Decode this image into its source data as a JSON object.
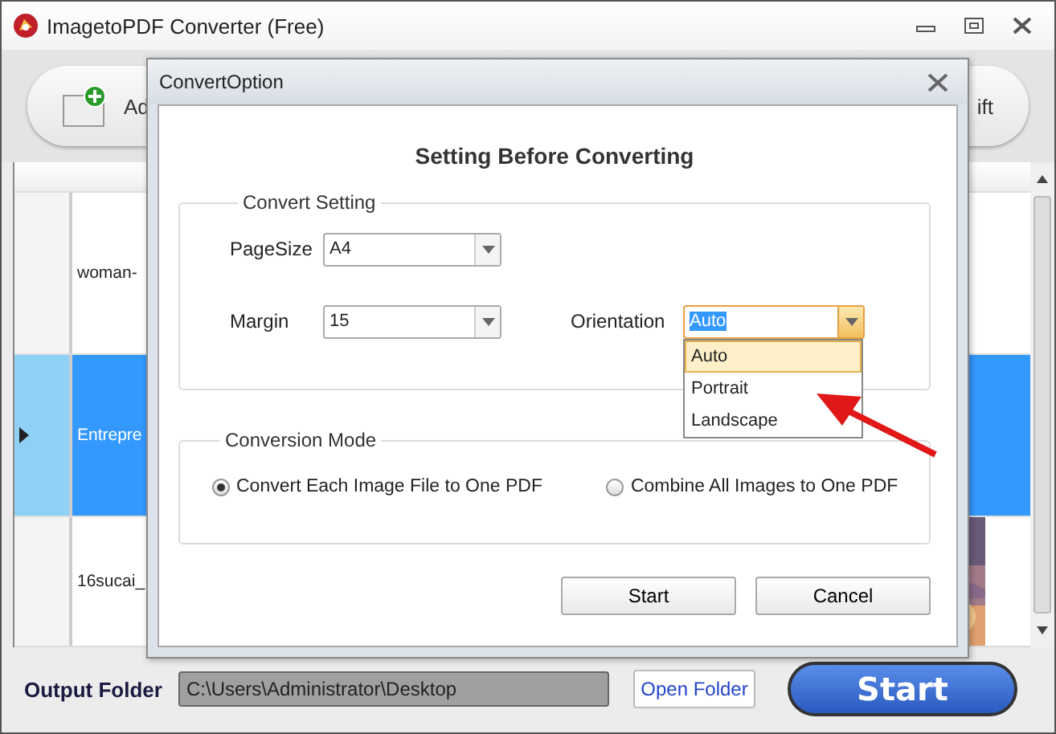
{
  "window": {
    "title": "ImagetoPDF Converter (Free)"
  },
  "toolbar": {
    "add_button": "Ad",
    "right_button": "ift"
  },
  "file_list": {
    "rows": [
      {
        "name": "woman-",
        "selected": false
      },
      {
        "name": "Entrepre",
        "selected": true
      },
      {
        "name": "16sucai_",
        "selected": false
      }
    ]
  },
  "output": {
    "label": "Output Folder",
    "path": "C:\\Users\\Administrator\\Desktop",
    "open_button": "Open Folder",
    "start_button": "Start"
  },
  "dialog": {
    "title": "ConvertOption",
    "heading": "Setting Before Converting",
    "convert_setting": {
      "legend": "Convert Setting",
      "fields": [
        {
          "label": "PageSize",
          "value": "A4"
        },
        {
          "label": "Margin",
          "value": "15"
        }
      ],
      "orientation": {
        "label": "Orientation",
        "value": "Auto",
        "expanded": true,
        "options": [
          {
            "label": "Auto",
            "selected": true
          },
          {
            "label": "Portrait",
            "selected": false
          },
          {
            "label": "Landscape",
            "selected": false
          }
        ]
      }
    },
    "conversion_mode": {
      "legend": "Conversion Mode",
      "options": [
        {
          "label": "Convert Each Image File to One PDF",
          "selected": true
        },
        {
          "label": "Combine All Images to One PDF",
          "selected": false
        }
      ]
    },
    "buttons": [
      "Start",
      "Cancel"
    ]
  }
}
